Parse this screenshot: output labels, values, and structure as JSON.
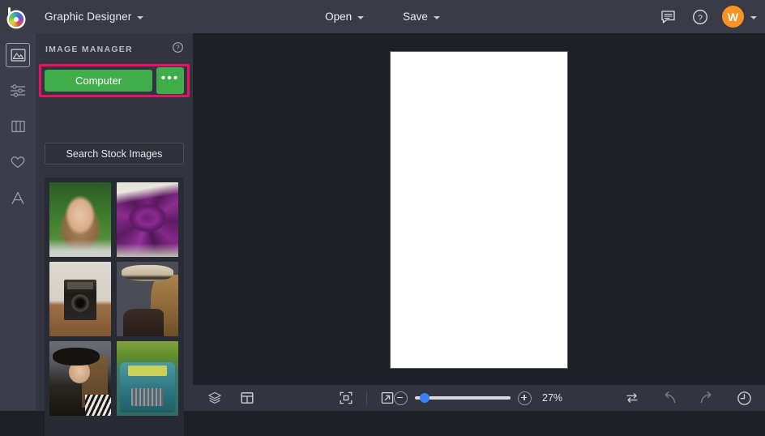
{
  "app": {
    "logo": "befunky-logo-icon",
    "product_menu": "Graphic Designer"
  },
  "topbar": {
    "open_label": "Open",
    "save_label": "Save",
    "feedback_icon": "chat-bubble-icon",
    "help_icon": "help-circle-icon",
    "avatar_initial": "W",
    "avatar_color": "#f79320"
  },
  "rail": {
    "items": [
      {
        "name": "sidebar-item-image-manager",
        "icon": "photo-icon",
        "active": true
      },
      {
        "name": "sidebar-item-edit",
        "icon": "sliders-icon",
        "active": false
      },
      {
        "name": "sidebar-item-templates",
        "icon": "columns-icon",
        "active": false
      },
      {
        "name": "sidebar-item-graphics",
        "icon": "heart-icon",
        "active": false
      },
      {
        "name": "sidebar-item-text",
        "icon": "text-a-icon",
        "active": false
      }
    ]
  },
  "panel": {
    "title": "IMAGE MANAGER",
    "help_icon": "help-circle-icon",
    "computer_button": "Computer",
    "more_button": "•••",
    "search_stock_button": "Search Stock Images",
    "highlight_color": "#ec1060",
    "button_color": "#40ad4b",
    "thumbnails": [
      {
        "name": "thumbnail-blonde-woman-hedge"
      },
      {
        "name": "thumbnail-purple-flower"
      },
      {
        "name": "thumbnail-vintage-camera"
      },
      {
        "name": "thumbnail-woman-straw-hat"
      },
      {
        "name": "thumbnail-woman-black-hat"
      },
      {
        "name": "thumbnail-teal-vintage-truck"
      }
    ]
  },
  "canvas": {
    "sheet_color": "#ffffff",
    "background_color": "#1e2026"
  },
  "bottombar": {
    "layers_icon": "layers-icon",
    "layout_icon": "layout-panel-icon",
    "fit_icon": "fit-to-screen-icon",
    "expand_icon": "expand-arrow-icon",
    "zoom_out_icon": "minus-circle-icon",
    "zoom_in_icon": "plus-circle-icon",
    "zoom_percent": "27%",
    "zoom_value": 27,
    "compare_icon": "compare-swap-icon",
    "undo_icon": "undo-arrow-icon",
    "redo_icon": "redo-arrow-icon",
    "history_icon": "history-clock-icon"
  }
}
